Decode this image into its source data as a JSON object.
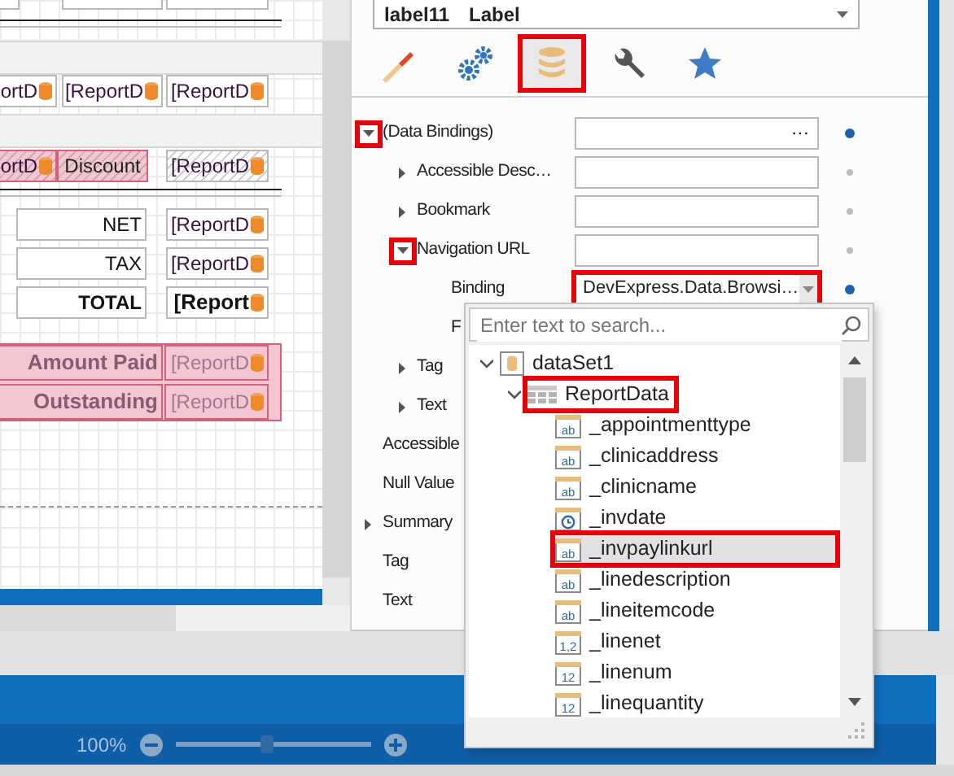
{
  "designer": {
    "top_row": [
      {
        "text": "ortD",
        "selected": false
      },
      {
        "text": "[ReportD",
        "selected": false
      },
      {
        "text": "[ReportD",
        "selected": false
      }
    ],
    "discount_row": [
      {
        "text": "ortD",
        "kind": "field",
        "selected": true
      },
      {
        "text": "Discount",
        "kind": "label",
        "selected": true
      },
      {
        "text": "[ReportD",
        "kind": "field",
        "selected": false
      }
    ],
    "totals": [
      {
        "label": "NET",
        "value": "[ReportD",
        "bold": false
      },
      {
        "label": "TAX",
        "value": "[ReportD",
        "bold": false
      },
      {
        "label": "TOTAL",
        "value": "[Report",
        "bold": true
      }
    ],
    "payments": [
      {
        "label": "Amount Paid",
        "value": "[ReportD",
        "selected": true
      },
      {
        "label": "Outstanding",
        "value": "[ReportD",
        "selected": true
      }
    ]
  },
  "properties_panel": {
    "selector": {
      "name": "label11",
      "type": "Label"
    },
    "tabs": [
      {
        "selected": false,
        "highlighted": false
      },
      {
        "selected": false,
        "highlighted": false
      },
      {
        "selected": true,
        "highlighted": true
      },
      {
        "selected": false,
        "highlighted": false
      },
      {
        "selected": false,
        "highlighted": false
      }
    ],
    "properties": [
      {
        "name": "(Data Bindings)",
        "kind": "button_field",
        "button": "···",
        "expanded": true,
        "highlighted": true,
        "modified": true,
        "children": [
          {
            "name": "Accessible Desc…",
            "kind": "field",
            "expanded": false,
            "highlighted": false,
            "modified": false
          },
          {
            "name": "Bookmark",
            "kind": "field",
            "expanded": false,
            "highlighted": false,
            "modified": false
          },
          {
            "name": "Navigation URL",
            "kind": "field",
            "expanded": true,
            "highlighted": true,
            "modified": false,
            "children": [
              {
                "name": "Binding",
                "kind": "combo",
                "value": "DevExpress.Data.Browsi…",
                "highlighted": true,
                "modified": true
              },
              {
                "name": "F",
                "kind": "label",
                "highlighted": false
              }
            ]
          },
          {
            "name": "Tag",
            "kind": "label",
            "expanded": false,
            "highlighted": false
          },
          {
            "name": "Text",
            "kind": "label",
            "expanded": false,
            "highlighted": false
          }
        ]
      },
      {
        "name": "Accessible",
        "kind": "label",
        "highlighted": false
      },
      {
        "name": "Null Value",
        "kind": "label",
        "highlighted": false
      },
      {
        "name": "Summary",
        "kind": "label",
        "expanded": false,
        "highlighted": false
      },
      {
        "name": "Tag",
        "kind": "label",
        "highlighted": false
      },
      {
        "name": "Text",
        "kind": "label",
        "highlighted": false
      }
    ]
  },
  "binding_popup": {
    "search": {
      "placeholder": "Enter text to search..."
    },
    "tree": [
      {
        "label": "dataSet1",
        "kind": "dataset",
        "expanded": true,
        "selected": false,
        "highlighted": false,
        "children": [
          {
            "label": "ReportData",
            "kind": "table",
            "expanded": true,
            "selected": false,
            "highlighted": true,
            "children": [
              {
                "label": "_appointmenttype",
                "kind": "text",
                "badge": "ab",
                "selected": false,
                "highlighted": false
              },
              {
                "label": "_clinicaddress",
                "kind": "text",
                "badge": "ab",
                "selected": false,
                "highlighted": false
              },
              {
                "label": "_clinicname",
                "kind": "text",
                "badge": "ab",
                "selected": false,
                "highlighted": false
              },
              {
                "label": "_invdate",
                "kind": "date",
                "selected": false,
                "highlighted": false
              },
              {
                "label": "_invpaylinkurl",
                "kind": "text",
                "badge": "ab",
                "selected": true,
                "highlighted": true
              },
              {
                "label": "_linedescription",
                "kind": "text",
                "badge": "ab",
                "selected": false,
                "highlighted": false
              },
              {
                "label": "_lineitemcode",
                "kind": "text",
                "badge": "ab",
                "selected": false,
                "highlighted": false
              },
              {
                "label": "_linenet",
                "kind": "decimal",
                "badge": "1,2",
                "selected": false,
                "highlighted": false
              },
              {
                "label": "_linenum",
                "kind": "integer",
                "badge": "12",
                "selected": false,
                "highlighted": false
              },
              {
                "label": "_linequantity",
                "kind": "integer",
                "badge": "12",
                "selected": false,
                "highlighted": false
              }
            ]
          }
        ]
      }
    ]
  },
  "status_bar": {
    "zoom": "100%",
    "level": 0.47
  }
}
